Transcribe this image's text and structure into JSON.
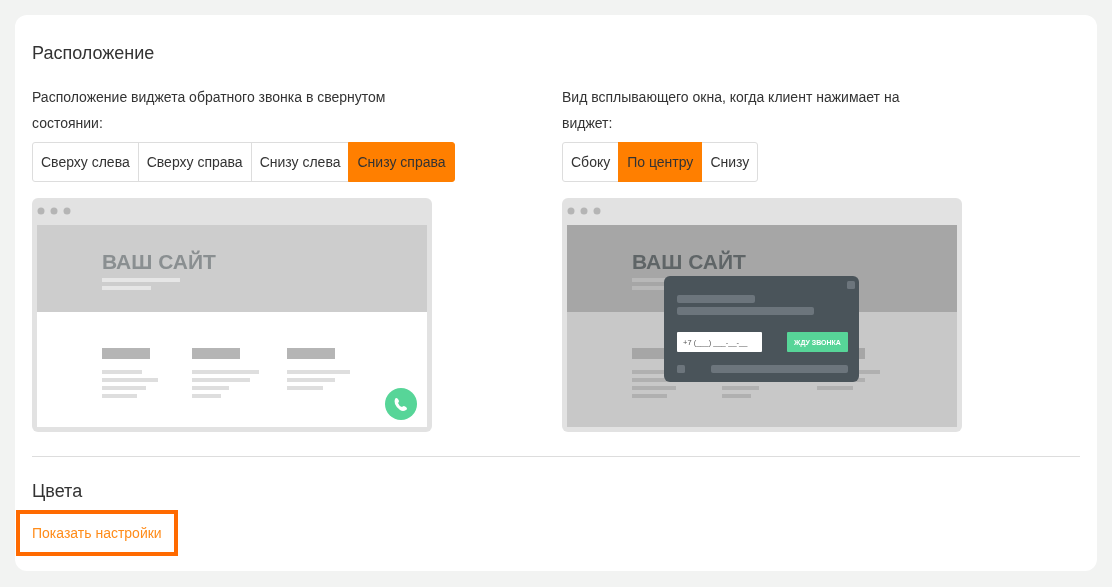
{
  "sections": [
    {
      "kind": "placement",
      "title": "Расположение",
      "groups": [
        {
          "description": "Расположение виджета обратного звонка в свернутом состоянии:",
          "options": [
            {
              "label": "Сверху слева",
              "selected": false
            },
            {
              "label": "Сверху справа",
              "selected": false
            },
            {
              "label": "Снизу слева",
              "selected": false
            },
            {
              "label": "Снизу справа",
              "selected": true
            }
          ],
          "preview": {
            "kind": "collapsed",
            "site_title": "ВАШ САЙТ"
          }
        },
        {
          "description": "Вид всплывающего окна, когда клиент нажимает на виджет:",
          "options": [
            {
              "label": "Сбоку",
              "selected": false
            },
            {
              "label": "По центру",
              "selected": true
            },
            {
              "label": "Снизу",
              "selected": false
            }
          ],
          "preview": {
            "kind": "popup",
            "site_title": "ВАШ САЙТ",
            "phone_text": "+7 (___) ___-__-__",
            "button_label": "ЖДУ ЗВОНКА"
          }
        }
      ]
    },
    {
      "kind": "colors",
      "title": "Цвета",
      "link": "Показать настройки"
    }
  ]
}
